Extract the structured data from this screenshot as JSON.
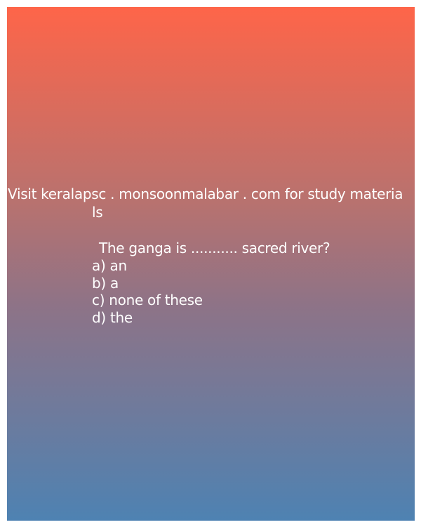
{
  "promo": {
    "line1": "Visit keralapsc . monsoonmalabar . com for study materia",
    "line2": "ls"
  },
  "quiz": {
    "question": "The ganga is ........... sacred river?",
    "options": [
      "a) an",
      "b) a",
      "c) none of these",
      "d) the"
    ]
  },
  "colors": {
    "gradient_top": "#fe6549",
    "gradient_bottom": "#4e82b2",
    "text": "#ffffff"
  }
}
